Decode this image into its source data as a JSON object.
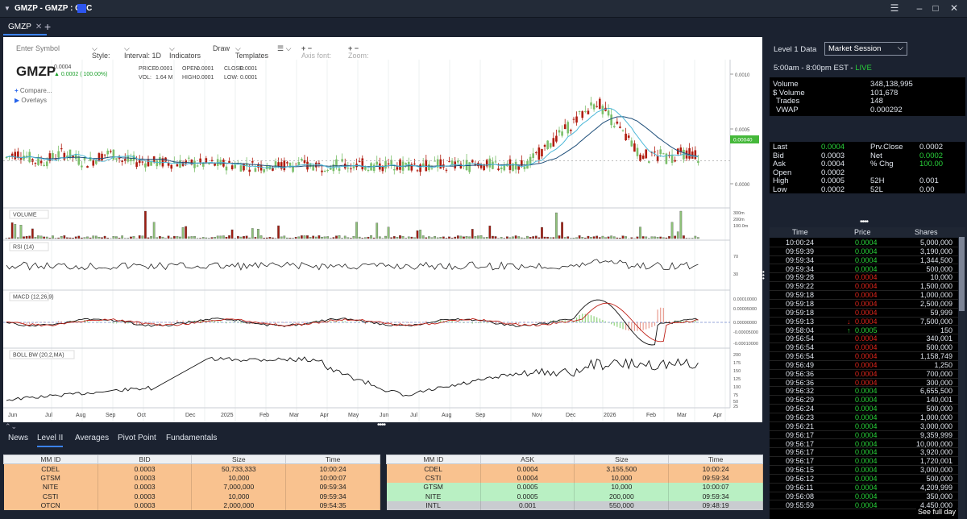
{
  "window": {
    "title": "GMZP - GMZP : OTC"
  },
  "tabs": [
    {
      "label": "GMZP"
    }
  ],
  "toolbar": {
    "symbol_placeholder": "Enter Symbol",
    "style": "Style:",
    "interval": "Interval: 1D",
    "indicators": "Indicators",
    "draw": "Draw",
    "templates": "Templates",
    "axis_font": "Axis font:",
    "zoom": "Zoom:"
  },
  "chart_info": {
    "symbol": "GMZP",
    "last": "0.0004",
    "change": "0.0002 ( 100.00%)",
    "price_label": "PRICE:",
    "price": "0.0001",
    "open_label": "OPEN:",
    "open": "0.0001",
    "close_label": "CLOSE:",
    "close": "0.0001",
    "vol_label": "VOL:",
    "vol": "1.64 M",
    "high_label": "HIGH:",
    "high": "0.0001",
    "low_label": "LOW:",
    "low": "0.0001",
    "compare": "Compare...",
    "overlays": "Overlays"
  },
  "chart_data": {
    "type": "candlestick",
    "x_ticks": [
      "Jun",
      "Jul",
      "Aug",
      "Sep",
      "Oct",
      "Dec",
      "2025",
      "Feb",
      "Mar",
      "Apr",
      "May",
      "Jun",
      "Jul",
      "Aug",
      "Sep",
      "Nov",
      "Dec",
      "2026",
      "Feb",
      "Mar",
      "Apr"
    ],
    "price_axis": {
      "ticks": [
        "0.0010",
        "0.0005",
        "0.0000"
      ],
      "last_label": "0.00040"
    },
    "volume_panel": {
      "label": "VOLUME",
      "ticks": [
        "300m",
        "200m",
        "100.0m"
      ]
    },
    "rsi_panel": {
      "label": "RSI (14)",
      "ticks": [
        "70",
        "30"
      ]
    },
    "macd_panel": {
      "label": "MACD (12,26,9)",
      "ticks": [
        "0.00010000",
        "0.00005000",
        "0.00000000",
        "-0.00005000",
        "-0.00010000"
      ]
    },
    "boll_panel": {
      "label": "BOLL BW (20,2,MA)",
      "ticks": [
        "200",
        "175",
        "150",
        "125",
        "100",
        "75",
        "50",
        "25"
      ]
    }
  },
  "bottom_tabs": [
    {
      "label": "News"
    },
    {
      "label": "Level II"
    },
    {
      "label": "Averages"
    },
    {
      "label": "Pivot Point"
    },
    {
      "label": "Fundamentals"
    }
  ],
  "level2_bid": {
    "headers": [
      "MM ID",
      "BID",
      "Size",
      "Time"
    ],
    "rows": [
      {
        "mm": "CDEL",
        "price": "0.0003",
        "size": "50,733,333",
        "time": "10:00:24",
        "style": "orange"
      },
      {
        "mm": "GTSM",
        "price": "0.0003",
        "size": "10,000",
        "time": "10:00:07",
        "style": "orange"
      },
      {
        "mm": "NITE",
        "price": "0.0003",
        "size": "7,000,000",
        "time": "09:59:34",
        "style": "orange"
      },
      {
        "mm": "CSTI",
        "price": "0.0003",
        "size": "10,000",
        "time": "09:59:34",
        "style": "orange"
      },
      {
        "mm": "OTCN",
        "price": "0.0003",
        "size": "2,000,000",
        "time": "09:54:35",
        "style": "orange"
      }
    ]
  },
  "level2_ask": {
    "headers": [
      "MM ID",
      "ASK",
      "Size",
      "Time"
    ],
    "rows": [
      {
        "mm": "CDEL",
        "price": "0.0004",
        "size": "3,155,500",
        "time": "10:00:24",
        "style": "orange"
      },
      {
        "mm": "CSTI",
        "price": "0.0004",
        "size": "10,000",
        "time": "09:59:34",
        "style": "orange"
      },
      {
        "mm": "GTSM",
        "price": "0.0005",
        "size": "10,000",
        "time": "10:00:07",
        "style": "green"
      },
      {
        "mm": "NITE",
        "price": "0.0005",
        "size": "200,000",
        "time": "09:59:34",
        "style": "green"
      },
      {
        "mm": "INTL",
        "price": "0.001",
        "size": "550,000",
        "time": "09:48:19",
        "style": "gray"
      }
    ]
  },
  "level1": {
    "title": "Level 1 Data",
    "session_option": "Market Session",
    "hours": "5:00am - 8:00pm EST - ",
    "live": "LIVE",
    "stats": [
      {
        "k": "Volume",
        "v": "348,138,995"
      },
      {
        "k": "$ Volume",
        "v": "101,678"
      },
      {
        "k": "Trades",
        "v": "148"
      },
      {
        "k": "VWAP",
        "v": "0.000292"
      }
    ],
    "quote_left": [
      {
        "k": "Last",
        "v": "0.0004",
        "hl": true
      },
      {
        "k": "Bid",
        "v": "0.0003"
      },
      {
        "k": "Ask",
        "v": "0.0004"
      },
      {
        "k": "Open",
        "v": "0.0002"
      },
      {
        "k": "High",
        "v": "0.0005"
      },
      {
        "k": "Low",
        "v": "0.0002"
      }
    ],
    "quote_right": [
      {
        "k": "Prv.Close",
        "v": "0.0002"
      },
      {
        "k": "Net",
        "v": "0.0002",
        "hl": true
      },
      {
        "k": "% Chg",
        "v": "100.00",
        "hl": true
      },
      {
        "k": "52H",
        "v": "0.001"
      },
      {
        "k": "52L",
        "v": "0.00"
      }
    ]
  },
  "time_sales": {
    "headers": [
      "Time",
      "Price",
      "Shares"
    ],
    "see_full_day": "See full day",
    "rows": [
      {
        "t": "10:00:24",
        "p": "0.0004",
        "s": "5,000,000",
        "c": "g"
      },
      {
        "t": "09:59:39",
        "p": "0.0004",
        "s": "3,190,000",
        "c": "g"
      },
      {
        "t": "09:59:34",
        "p": "0.0004",
        "s": "1,344,500",
        "c": "g"
      },
      {
        "t": "09:59:34",
        "p": "0.0004",
        "s": "500,000",
        "c": "g"
      },
      {
        "t": "09:59:28",
        "p": "0.0004",
        "s": "10,000",
        "c": "r"
      },
      {
        "t": "09:59:22",
        "p": "0.0004",
        "s": "1,500,000",
        "c": "r"
      },
      {
        "t": "09:59:18",
        "p": "0.0004",
        "s": "1,000,000",
        "c": "r"
      },
      {
        "t": "09:59:18",
        "p": "0.0004",
        "s": "2,500,009",
        "c": "r"
      },
      {
        "t": "09:59:18",
        "p": "0.0004",
        "s": "59,999",
        "c": "r"
      },
      {
        "t": "09:59:13",
        "p": "0.0004",
        "s": "7,500,000",
        "c": "r",
        "arrow": "down"
      },
      {
        "t": "09:58:04",
        "p": "0.0005",
        "s": "150",
        "c": "g",
        "arrow": "up"
      },
      {
        "t": "09:56:54",
        "p": "0.0004",
        "s": "340,001",
        "c": "r"
      },
      {
        "t": "09:56:54",
        "p": "0.0004",
        "s": "500,000",
        "c": "r"
      },
      {
        "t": "09:56:54",
        "p": "0.0004",
        "s": "1,158,749",
        "c": "r"
      },
      {
        "t": "09:56:49",
        "p": "0.0004",
        "s": "1,250",
        "c": "r"
      },
      {
        "t": "09:56:36",
        "p": "0.0004",
        "s": "700,000",
        "c": "r"
      },
      {
        "t": "09:56:36",
        "p": "0.0004",
        "s": "300,000",
        "c": "r"
      },
      {
        "t": "09:56:32",
        "p": "0.0004",
        "s": "6,655,500",
        "c": "g"
      },
      {
        "t": "09:56:29",
        "p": "0.0004",
        "s": "140,001",
        "c": "g"
      },
      {
        "t": "09:56:24",
        "p": "0.0004",
        "s": "500,000",
        "c": "g"
      },
      {
        "t": "09:56:23",
        "p": "0.0004",
        "s": "1,000,000",
        "c": "g"
      },
      {
        "t": "09:56:21",
        "p": "0.0004",
        "s": "3,000,000",
        "c": "g"
      },
      {
        "t": "09:56:17",
        "p": "0.0004",
        "s": "9,359,999",
        "c": "g"
      },
      {
        "t": "09:56:17",
        "p": "0.0004",
        "s": "10,000,000",
        "c": "g"
      },
      {
        "t": "09:56:17",
        "p": "0.0004",
        "s": "3,920,000",
        "c": "g"
      },
      {
        "t": "09:56:17",
        "p": "0.0004",
        "s": "1,720,001",
        "c": "g"
      },
      {
        "t": "09:56:15",
        "p": "0.0004",
        "s": "3,000,000",
        "c": "g"
      },
      {
        "t": "09:56:12",
        "p": "0.0004",
        "s": "500,000",
        "c": "g"
      },
      {
        "t": "09:56:11",
        "p": "0.0004",
        "s": "4,209,999",
        "c": "g"
      },
      {
        "t": "09:56:08",
        "p": "0.0004",
        "s": "350,000",
        "c": "g"
      },
      {
        "t": "09:55:59",
        "p": "0.0004",
        "s": "4,450,000",
        "c": "g"
      }
    ]
  },
  "colors": {
    "up": "#1b9f2a",
    "down": "#b01b0e",
    "live": "#29d13a",
    "accent": "#3b82f6"
  }
}
